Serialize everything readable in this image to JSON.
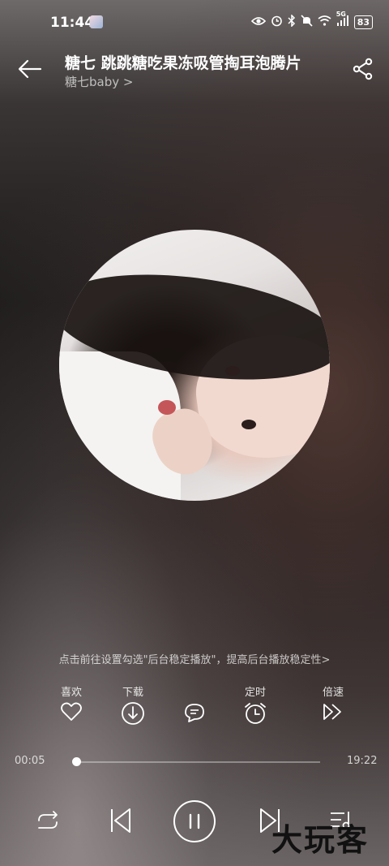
{
  "status_bar": {
    "time": "11:44",
    "battery": "83",
    "network": "5G"
  },
  "header": {
    "title": "糖七 跳跳糖吃果冻吸管掏耳泡腾片",
    "artist": "糖七baby >"
  },
  "notice": "点击前往设置勾选\"后台稳定播放\"，提高后台播放稳定性>",
  "actions": [
    {
      "label": "喜欢",
      "icon": "heart-icon"
    },
    {
      "label": "下载",
      "icon": "download-icon"
    },
    {
      "label": "",
      "icon": "comment-icon"
    },
    {
      "label": "定时",
      "icon": "alarm-icon"
    },
    {
      "label": "倍速",
      "icon": "speed-icon"
    }
  ],
  "progress": {
    "current": "00:05",
    "total": "19:22",
    "fraction": 0.004
  },
  "controls": [
    "repeat-icon",
    "previous-icon",
    "pause-icon",
    "next-icon",
    "playlist-icon"
  ],
  "watermark": "大玩客"
}
